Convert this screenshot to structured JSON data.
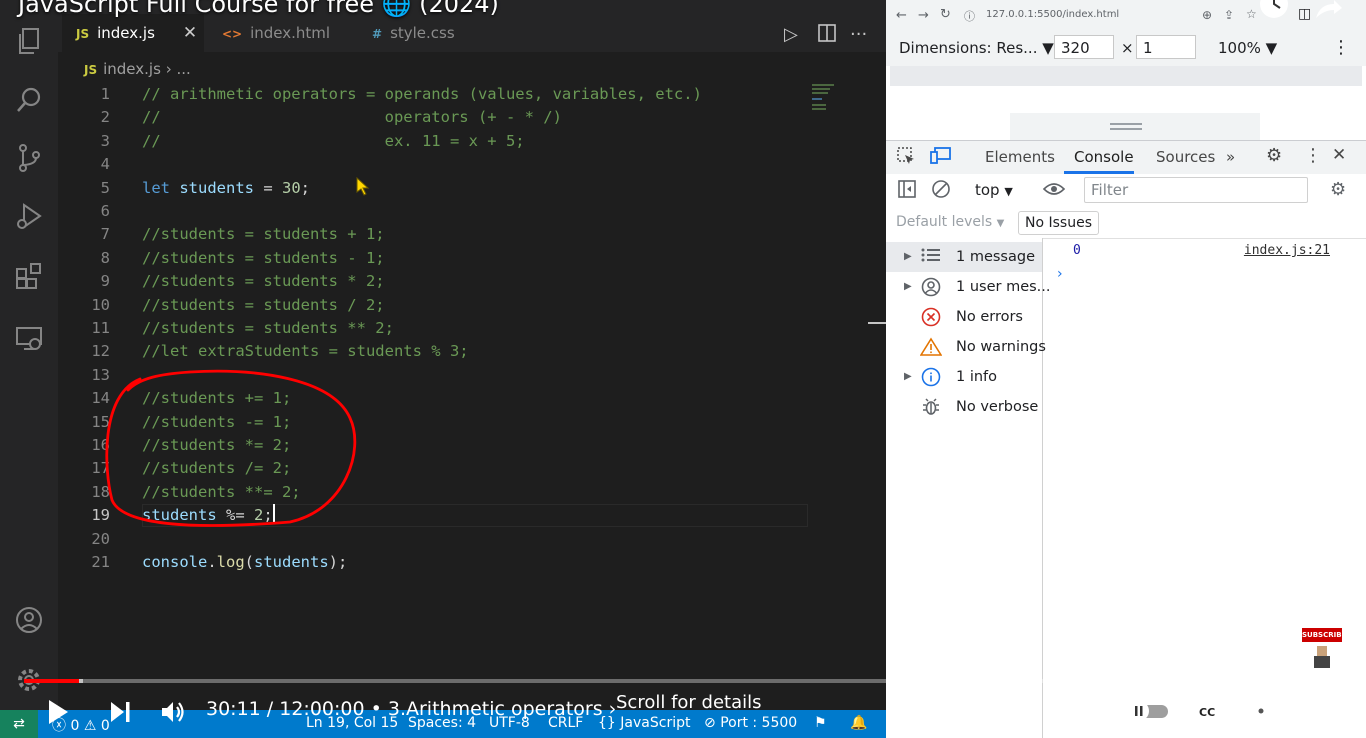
{
  "video": {
    "title": "JavaScript Full Course for free 🌐 (2024)",
    "time": "30:11 / 12:00:00",
    "chapter": "• 3.Arithmetic operators ›",
    "scroll_hint": "Scroll for details",
    "progress_pct": 4.2,
    "subscribe_label": "SUBSCRIBE"
  },
  "editor": {
    "tabs": [
      {
        "label": "index.js",
        "icon": "JS",
        "active": true
      },
      {
        "label": "index.html",
        "icon": "<>",
        "active": false
      },
      {
        "label": "style.css",
        "icon": "#",
        "active": false
      }
    ],
    "breadcrumb": {
      "file": "index.js",
      "rest": "› ..."
    },
    "lines": [
      {
        "n": "1",
        "text": "// arithmetic operators = operands (values, variables, etc.)",
        "kind": "comment"
      },
      {
        "n": "2",
        "text": "//                        operators (+ - * /)",
        "kind": "comment"
      },
      {
        "n": "3",
        "text": "//                        ex. 11 = x + 5;",
        "kind": "comment"
      },
      {
        "n": "4",
        "text": "",
        "kind": "plain"
      },
      {
        "n": "5",
        "text": "let students = 30;",
        "kind": "let"
      },
      {
        "n": "6",
        "text": "",
        "kind": "plain"
      },
      {
        "n": "7",
        "text": "//students = students + 1;",
        "kind": "comment"
      },
      {
        "n": "8",
        "text": "//students = students - 1;",
        "kind": "comment"
      },
      {
        "n": "9",
        "text": "//students = students * 2;",
        "kind": "comment"
      },
      {
        "n": "10",
        "text": "//students = students / 2;",
        "kind": "comment"
      },
      {
        "n": "11",
        "text": "//students = students ** 2;",
        "kind": "comment"
      },
      {
        "n": "12",
        "text": "//let extraStudents = students % 3;",
        "kind": "comment"
      },
      {
        "n": "13",
        "text": "",
        "kind": "plain"
      },
      {
        "n": "14",
        "text": "//students += 1;",
        "kind": "comment"
      },
      {
        "n": "15",
        "text": "//students -= 1;",
        "kind": "comment"
      },
      {
        "n": "16",
        "text": "//students *= 2;",
        "kind": "comment"
      },
      {
        "n": "17",
        "text": "//students /= 2;",
        "kind": "comment"
      },
      {
        "n": "18",
        "text": "//students **= 2;",
        "kind": "comment"
      },
      {
        "n": "19",
        "text": "students %= 2;",
        "kind": "assign"
      },
      {
        "n": "20",
        "text": "",
        "kind": "plain"
      },
      {
        "n": "21",
        "text": "console.log(students);",
        "kind": "log"
      }
    ],
    "current_line": "19"
  },
  "statusbar": {
    "errors": "0",
    "warnings": "0",
    "position": "Ln 19, Col 15",
    "spaces": "Spaces: 4",
    "encoding": "UTF-8",
    "eol": "CRLF",
    "language": "JavaScript",
    "port": "Port : 5500"
  },
  "browser": {
    "url": "127.0.0.1:5500/index.html",
    "dimensions_label": "Dimensions: Res...",
    "width": "320",
    "height": "1",
    "zoom": "100%"
  },
  "devtools": {
    "tabs": [
      "Elements",
      "Console",
      "Sources"
    ],
    "active_tab": "Console",
    "context": "top",
    "filter_placeholder": "Filter",
    "default_levels": "Default levels",
    "issues": "No Issues",
    "sidebar": [
      {
        "label": "1 message",
        "icon": "list-icon",
        "expandable": true,
        "selected": true
      },
      {
        "label": "1 user mes...",
        "icon": "user-icon",
        "expandable": true,
        "selected": false
      },
      {
        "label": "No errors",
        "icon": "error-icon",
        "expandable": false,
        "selected": false
      },
      {
        "label": "No warnings",
        "icon": "warning-icon",
        "expandable": false,
        "selected": false
      },
      {
        "label": "1 info",
        "icon": "info-icon",
        "expandable": true,
        "selected": false
      },
      {
        "label": "No verbose",
        "icon": "bug-icon",
        "expandable": false,
        "selected": false
      }
    ],
    "log_value": "0",
    "log_source": "index.js:21"
  },
  "colors": {
    "annotation": "#ff0000",
    "statusbar": "#007acc",
    "progress": "#ff0000"
  }
}
